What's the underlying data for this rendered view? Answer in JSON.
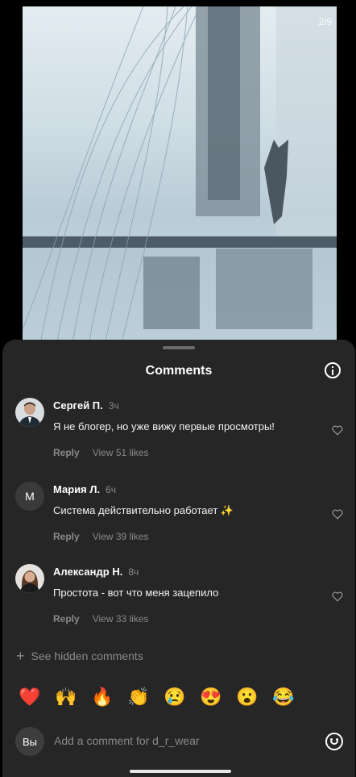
{
  "media": {
    "counter": "2/9"
  },
  "sheet": {
    "title": "Comments"
  },
  "comments": [
    {
      "name": "Сергей П.",
      "time": "3ч",
      "text": "Я не блогер, но уже вижу первые просмотры!",
      "reply": "Reply",
      "likes": "View 51 likes",
      "avatar_letter": ""
    },
    {
      "name": "Мария Л.",
      "time": "6ч",
      "text": "Система действительно работает ✨",
      "reply": "Reply",
      "likes": "View 39 likes",
      "avatar_letter": "M"
    },
    {
      "name": "Александр Н.",
      "time": "8ч",
      "text": "Простота - вот что меня зацепило",
      "reply": "Reply",
      "likes": "View 33 likes",
      "avatar_letter": ""
    }
  ],
  "hidden_comments": "See hidden comments",
  "reactions": [
    "❤️",
    "🙌",
    "🔥",
    "👏",
    "😢",
    "😍",
    "😮",
    "😂"
  ],
  "composer": {
    "avatar": "Вы",
    "placeholder": "Add a comment for d_r_wear"
  },
  "colors": {
    "sheet": "#262626",
    "muted": "#8a8a8a"
  }
}
